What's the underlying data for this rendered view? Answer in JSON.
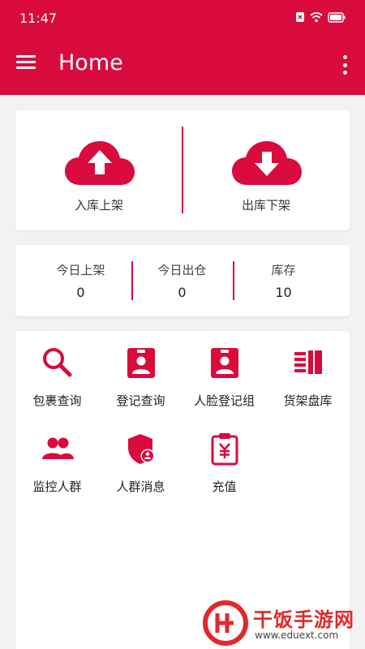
{
  "status_bar": {
    "time": "11:47"
  },
  "toolbar": {
    "title": "Home"
  },
  "actions": [
    {
      "label": "入库上架",
      "icon": "cloud-upload-icon"
    },
    {
      "label": "出库下架",
      "icon": "cloud-download-icon"
    }
  ],
  "stats": [
    {
      "label": "今日上架",
      "value": "0"
    },
    {
      "label": "今日出仓",
      "value": "0"
    },
    {
      "label": "库存",
      "value": "10"
    }
  ],
  "functions": [
    {
      "label": "包裹查询",
      "icon": "search-icon"
    },
    {
      "label": "登记查询",
      "icon": "badge-icon"
    },
    {
      "label": "人脸登记组",
      "icon": "badge-icon"
    },
    {
      "label": "货架盘库",
      "icon": "shelf-icon"
    },
    {
      "label": "监控人群",
      "icon": "group-icon"
    },
    {
      "label": "人群消息",
      "icon": "shield-user-icon"
    },
    {
      "label": "充值",
      "icon": "recharge-clipboard-icon"
    }
  ],
  "watermark": {
    "brand": "干饭手游网",
    "url": "www.eduext.com"
  },
  "colors": {
    "primary": "#d90a3c",
    "background": "#f2f2f4",
    "card": "#ffffff"
  }
}
